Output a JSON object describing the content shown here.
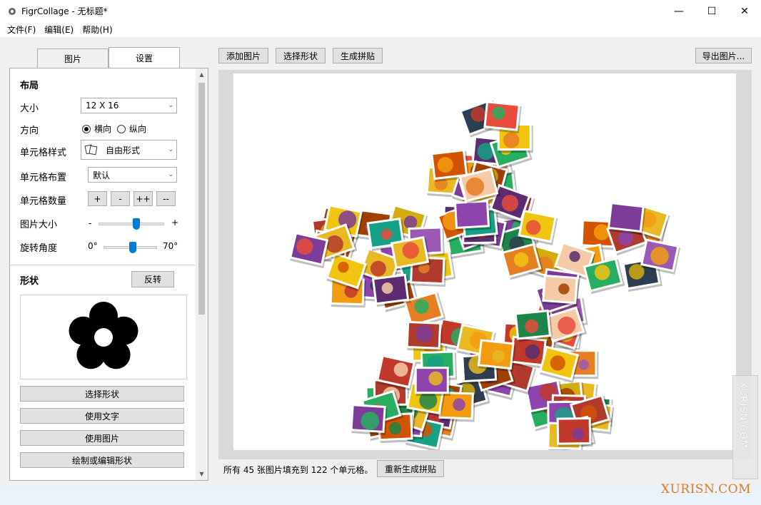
{
  "window": {
    "title": "FigrCollage - 无标题*",
    "minimize_glyph": "—",
    "maximize_glyph": "☐",
    "close_glyph": "✕"
  },
  "menu": [
    "文件(F)",
    "编辑(E)",
    "帮助(H)"
  ],
  "tabs": {
    "pictures": "图片",
    "settings": "设置",
    "active": "settings"
  },
  "layout": {
    "section_title": "布局",
    "size_label": "大小",
    "size_value": "12 X 16",
    "orientation_label": "方向",
    "orientation_landscape": "横向",
    "orientation_portrait": "纵向",
    "orientation_selected": "landscape",
    "cell_style_label": "单元格样式",
    "cell_style_value": "自由形式",
    "cell_arrangement_label": "单元格布置",
    "cell_arrangement_value": "默认",
    "cell_count_label": "单元格数量",
    "cell_count_buttons": [
      "+",
      "-",
      "++",
      "--"
    ],
    "picture_size_label": "图片大小",
    "picture_size_min": "-",
    "picture_size_max": "+",
    "picture_size_level": 0.58,
    "rotation_label": "旋转角度",
    "rotation_min": "0°",
    "rotation_max": "70°",
    "rotation_level": 0.55
  },
  "shape": {
    "section_title": "形状",
    "invert_button": "反转",
    "select_shape_button": "选择形状",
    "use_text_button": "使用文字",
    "use_image_button": "使用图片",
    "draw_edit_button": "绘制或编辑形状",
    "shape_icon": "flower-icon"
  },
  "toolbar": {
    "add_pictures": "添加图片",
    "select_shape": "选择形状",
    "generate": "生成拼贴",
    "export": "导出图片..."
  },
  "status": {
    "message": "所有 45 张图片填充到 122 个单元格。",
    "regenerate": "重新生成拼贴"
  },
  "watermark": {
    "bottom": "XURISN.COM",
    "side": "XURISN.COM"
  },
  "collage": {
    "photo_count": 122,
    "palette": [
      "#e8b923",
      "#c0392b",
      "#8e44ad",
      "#d35400",
      "#27ae60",
      "#f1c40f",
      "#e74c3c",
      "#9b59b6",
      "#e67e22",
      "#2c3e50",
      "#f39c12",
      "#c0392b",
      "#16a085",
      "#d4ac0d",
      "#a04000",
      "#7d3c98",
      "#b03a2e",
      "#f5cba7",
      "#5b2c6f",
      "#1e8449"
    ]
  }
}
